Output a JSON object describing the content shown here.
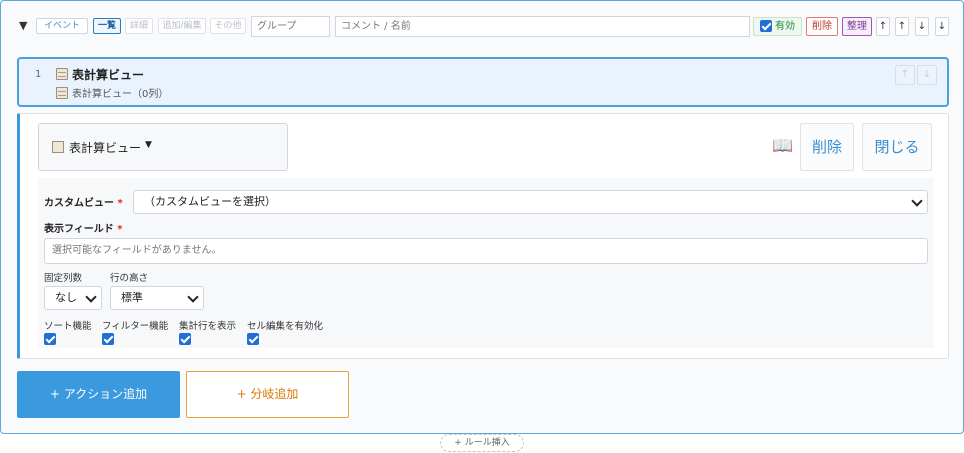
{
  "header": {
    "toggle": "▼",
    "tags": [
      "イベント",
      "一覧",
      "詳細",
      "追加/編集",
      "その他"
    ],
    "group_placeholder": "グループ",
    "comment_placeholder": "コメント / 名前",
    "enabled_label": "有効",
    "delete_label": "削除",
    "organize_label": "整理",
    "arrow_top": "↑",
    "arrow_up": "↑",
    "arrow_down": "↓",
    "arrow_bottom": "↓"
  },
  "rule": {
    "number": "1",
    "title": "表計算ビュー",
    "subtitle": "表計算ビュー（0列）",
    "up": "↑",
    "down": "↓"
  },
  "action": {
    "type_label": "表計算ビュー",
    "caret": "▼",
    "manual_icon": "book-icon",
    "delete_label": "削除",
    "close_label": "閉じる"
  },
  "form": {
    "custom_view_label": "カスタムビュー",
    "custom_view_value": "（カスタムビューを選択）",
    "required_mark": "*",
    "fields_label": "表示フィールド",
    "fields_placeholder": "選択可能なフィールドがありません。",
    "fixed_cols_label": "固定列数",
    "fixed_cols_value": "なし",
    "row_height_label": "行の高さ",
    "row_height_value": "標準",
    "options": [
      {
        "label": "ソート機能",
        "checked": true
      },
      {
        "label": "フィルター機能",
        "checked": true
      },
      {
        "label": "集計行を表示",
        "checked": true
      },
      {
        "label": "セル編集を有効化",
        "checked": true
      }
    ]
  },
  "buttons": {
    "add_action": "+ アクション追加",
    "add_branch": "+ 分岐追加",
    "insert_rule": "+ ルール挿入"
  },
  "colors": {
    "accent": "#3b9ade",
    "branch": "#d97706",
    "delete": "#c0392b",
    "organize": "#7d3c98",
    "enabled": "#1d8a3a"
  }
}
